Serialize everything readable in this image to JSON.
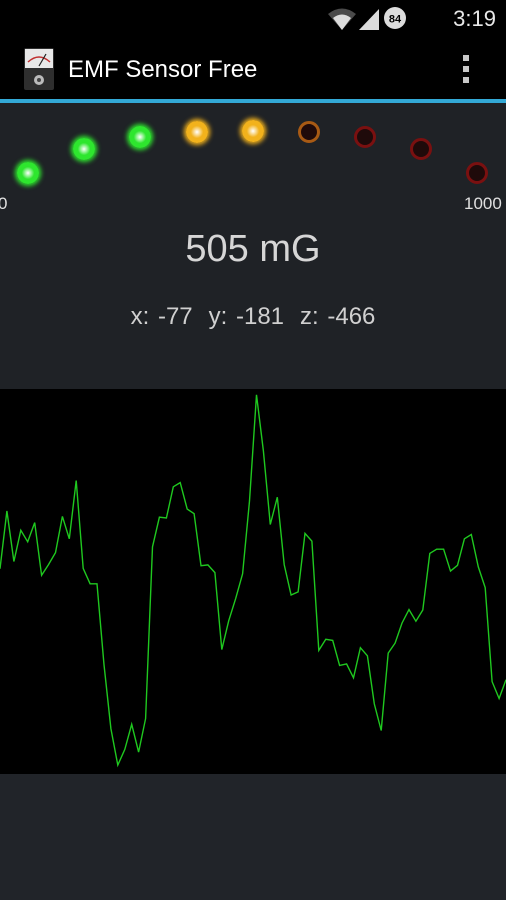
{
  "status_bar": {
    "time": "3:19",
    "battery_level": "84",
    "icons": [
      "wifi-icon",
      "signal-icon",
      "battery-icon"
    ]
  },
  "app_bar": {
    "title": "EMF Sensor Free",
    "icon": "emf-meter-icon",
    "menu_icon": "overflow-menu-icon"
  },
  "meter": {
    "scale_min": "0",
    "scale_max": "1000",
    "leds": [
      {
        "color": "green",
        "lit": true
      },
      {
        "color": "green",
        "lit": true
      },
      {
        "color": "green",
        "lit": true
      },
      {
        "color": "yellow",
        "lit": true
      },
      {
        "color": "yellow",
        "lit": true
      },
      {
        "color": "orange",
        "lit": false
      },
      {
        "color": "red",
        "lit": false
      },
      {
        "color": "red",
        "lit": false
      },
      {
        "color": "red",
        "lit": false
      }
    ],
    "reading": "505 mG",
    "x_text": "x: -77",
    "y_text": "y: -181",
    "z_text": "z: -466"
  },
  "colors": {
    "accent": "#33a9d6",
    "graph_line": "#1fc81f",
    "led_green": "#2ee62e",
    "led_yellow": "#f2b21c",
    "led_orange": "#a85a14",
    "led_red": "#7a1010"
  },
  "graph": {
    "series": [
      0.533,
      0.683,
      0.552,
      0.633,
      0.603,
      0.653,
      0.516,
      0.544,
      0.575,
      0.669,
      0.611,
      0.762,
      0.534,
      0.494,
      0.494,
      0.284,
      0.118,
      0.023,
      0.064,
      0.129,
      0.057,
      0.144,
      0.59,
      0.667,
      0.665,
      0.746,
      0.757,
      0.688,
      0.676,
      0.541,
      0.543,
      0.523,
      0.323,
      0.398,
      0.456,
      0.52,
      0.709,
      0.985,
      0.839,
      0.648,
      0.719,
      0.544,
      0.465,
      0.473,
      0.625,
      0.605,
      0.321,
      0.35,
      0.347,
      0.282,
      0.286,
      0.25,
      0.328,
      0.307,
      0.182,
      0.113,
      0.314,
      0.34,
      0.392,
      0.427,
      0.397,
      0.426,
      0.573,
      0.584,
      0.584,
      0.527,
      0.542,
      0.611,
      0.622,
      0.538,
      0.484,
      0.24,
      0.196,
      0.245
    ]
  }
}
